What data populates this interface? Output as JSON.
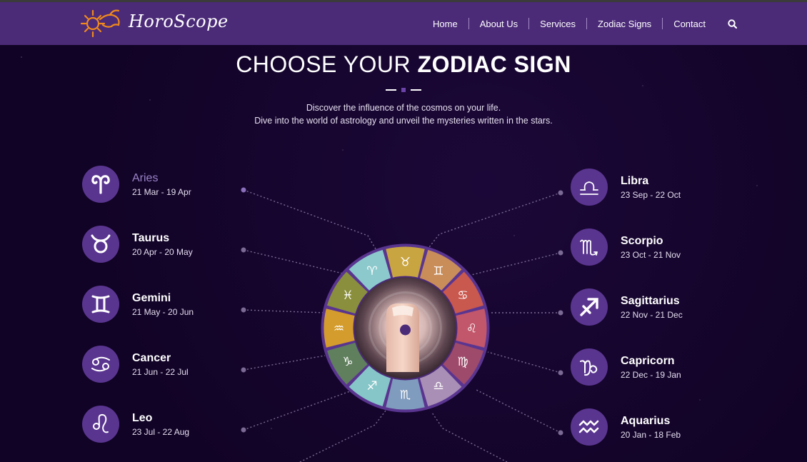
{
  "header": {
    "brand": "HoroScope",
    "nav": [
      {
        "label": "Home"
      },
      {
        "label": "About Us"
      },
      {
        "label": "Services"
      },
      {
        "label": "Zodiac Signs"
      },
      {
        "label": "Contact"
      }
    ],
    "search_icon": "search-icon"
  },
  "hero": {
    "title_light": "CHOOSE YOUR",
    "title_bold": "ZODIAC SIGN",
    "subtitle_line1": "Discover the influence of the cosmos on your life.",
    "subtitle_line2": "Dive into the world of astrology and unveil the mysteries written in the stars."
  },
  "signs_left": [
    {
      "name": "Aries",
      "dates": "21 Mar - 19 Apr",
      "icon": "aries-icon",
      "active": true
    },
    {
      "name": "Taurus",
      "dates": "20 Apr - 20 May",
      "icon": "taurus-icon"
    },
    {
      "name": "Gemini",
      "dates": "21 May - 20 Jun",
      "icon": "gemini-icon"
    },
    {
      "name": "Cancer",
      "dates": "21 Jun - 22 Jul",
      "icon": "cancer-icon"
    },
    {
      "name": "Leo",
      "dates": "23 Jul - 22 Aug",
      "icon": "leo-icon"
    }
  ],
  "signs_right": [
    {
      "name": "Libra",
      "dates": "23 Sep - 22 Oct",
      "icon": "libra-icon"
    },
    {
      "name": "Scorpio",
      "dates": "23 Oct - 21 Nov",
      "icon": "scorpio-icon"
    },
    {
      "name": "Sagittarius",
      "dates": "22 Nov - 21 Dec",
      "icon": "sagittarius-icon"
    },
    {
      "name": "Capricorn",
      "dates": "22 Dec - 19 Jan",
      "icon": "capricorn-icon"
    },
    {
      "name": "Aquarius",
      "dates": "20 Jan - 18 Feb",
      "icon": "aquarius-icon"
    }
  ],
  "wheel": {
    "segment_colors": [
      "#c9a542",
      "#c98d5a",
      "#c9584e",
      "#c2566a",
      "#9e4a6a",
      "#a98fb5",
      "#7f9bbd",
      "#86c5c8",
      "#5f7f5d",
      "#d49c2c",
      "#8a8f3d",
      "#8cc9cc"
    ],
    "segment_icons": [
      "taurus-glyph",
      "gemini-glyph",
      "cancer-glyph",
      "leo-glyph",
      "virgo-glyph",
      "libra-glyph",
      "scorpio-glyph",
      "sagittarius-glyph",
      "capricorn-glyph",
      "aquarius-glyph",
      "pisces-glyph",
      "aries-glyph"
    ]
  },
  "colors": {
    "header_bg": "#4b2a78",
    "icon_circle": "#5a3590",
    "active_label": "#9b83c9",
    "page_bg": "#13052a"
  }
}
